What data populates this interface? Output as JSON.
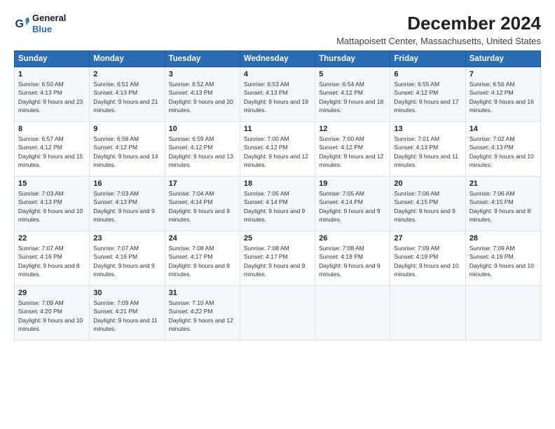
{
  "logo": {
    "line1": "General",
    "line2": "Blue"
  },
  "title": "December 2024",
  "subtitle": "Mattapoisett Center, Massachusetts, United States",
  "days_of_week": [
    "Sunday",
    "Monday",
    "Tuesday",
    "Wednesday",
    "Thursday",
    "Friday",
    "Saturday"
  ],
  "weeks": [
    [
      {
        "day": "1",
        "sunrise": "6:50 AM",
        "sunset": "4:13 PM",
        "daylight": "9 hours and 23 minutes."
      },
      {
        "day": "2",
        "sunrise": "6:51 AM",
        "sunset": "4:13 PM",
        "daylight": "9 hours and 21 minutes."
      },
      {
        "day": "3",
        "sunrise": "6:52 AM",
        "sunset": "4:13 PM",
        "daylight": "9 hours and 20 minutes."
      },
      {
        "day": "4",
        "sunrise": "6:53 AM",
        "sunset": "4:13 PM",
        "daylight": "9 hours and 19 minutes."
      },
      {
        "day": "5",
        "sunrise": "6:54 AM",
        "sunset": "4:12 PM",
        "daylight": "9 hours and 18 minutes."
      },
      {
        "day": "6",
        "sunrise": "6:55 AM",
        "sunset": "4:12 PM",
        "daylight": "9 hours and 17 minutes."
      },
      {
        "day": "7",
        "sunrise": "6:56 AM",
        "sunset": "4:12 PM",
        "daylight": "9 hours and 16 minutes."
      }
    ],
    [
      {
        "day": "8",
        "sunrise": "6:57 AM",
        "sunset": "4:12 PM",
        "daylight": "9 hours and 15 minutes."
      },
      {
        "day": "9",
        "sunrise": "6:58 AM",
        "sunset": "4:12 PM",
        "daylight": "9 hours and 14 minutes."
      },
      {
        "day": "10",
        "sunrise": "6:59 AM",
        "sunset": "4:12 PM",
        "daylight": "9 hours and 13 minutes."
      },
      {
        "day": "11",
        "sunrise": "7:00 AM",
        "sunset": "4:12 PM",
        "daylight": "9 hours and 12 minutes."
      },
      {
        "day": "12",
        "sunrise": "7:00 AM",
        "sunset": "4:12 PM",
        "daylight": "9 hours and 12 minutes."
      },
      {
        "day": "13",
        "sunrise": "7:01 AM",
        "sunset": "4:13 PM",
        "daylight": "9 hours and 11 minutes."
      },
      {
        "day": "14",
        "sunrise": "7:02 AM",
        "sunset": "4:13 PM",
        "daylight": "9 hours and 10 minutes."
      }
    ],
    [
      {
        "day": "15",
        "sunrise": "7:03 AM",
        "sunset": "4:13 PM",
        "daylight": "9 hours and 10 minutes."
      },
      {
        "day": "16",
        "sunrise": "7:03 AM",
        "sunset": "4:13 PM",
        "daylight": "9 hours and 9 minutes."
      },
      {
        "day": "17",
        "sunrise": "7:04 AM",
        "sunset": "4:14 PM",
        "daylight": "9 hours and 9 minutes."
      },
      {
        "day": "18",
        "sunrise": "7:05 AM",
        "sunset": "4:14 PM",
        "daylight": "9 hours and 9 minutes."
      },
      {
        "day": "19",
        "sunrise": "7:05 AM",
        "sunset": "4:14 PM",
        "daylight": "9 hours and 9 minutes."
      },
      {
        "day": "20",
        "sunrise": "7:06 AM",
        "sunset": "4:15 PM",
        "daylight": "9 hours and 9 minutes."
      },
      {
        "day": "21",
        "sunrise": "7:06 AM",
        "sunset": "4:15 PM",
        "daylight": "9 hours and 8 minutes."
      }
    ],
    [
      {
        "day": "22",
        "sunrise": "7:07 AM",
        "sunset": "4:16 PM",
        "daylight": "9 hours and 8 minutes."
      },
      {
        "day": "23",
        "sunrise": "7:07 AM",
        "sunset": "4:16 PM",
        "daylight": "9 hours and 9 minutes."
      },
      {
        "day": "24",
        "sunrise": "7:08 AM",
        "sunset": "4:17 PM",
        "daylight": "9 hours and 9 minutes."
      },
      {
        "day": "25",
        "sunrise": "7:08 AM",
        "sunset": "4:17 PM",
        "daylight": "9 hours and 9 minutes."
      },
      {
        "day": "26",
        "sunrise": "7:08 AM",
        "sunset": "4:18 PM",
        "daylight": "9 hours and 9 minutes."
      },
      {
        "day": "27",
        "sunrise": "7:09 AM",
        "sunset": "4:19 PM",
        "daylight": "9 hours and 10 minutes."
      },
      {
        "day": "28",
        "sunrise": "7:09 AM",
        "sunset": "4:19 PM",
        "daylight": "9 hours and 10 minutes."
      }
    ],
    [
      {
        "day": "29",
        "sunrise": "7:09 AM",
        "sunset": "4:20 PM",
        "daylight": "9 hours and 10 minutes."
      },
      {
        "day": "30",
        "sunrise": "7:09 AM",
        "sunset": "4:21 PM",
        "daylight": "9 hours and 11 minutes."
      },
      {
        "day": "31",
        "sunrise": "7:10 AM",
        "sunset": "4:22 PM",
        "daylight": "9 hours and 12 minutes."
      },
      null,
      null,
      null,
      null
    ]
  ]
}
